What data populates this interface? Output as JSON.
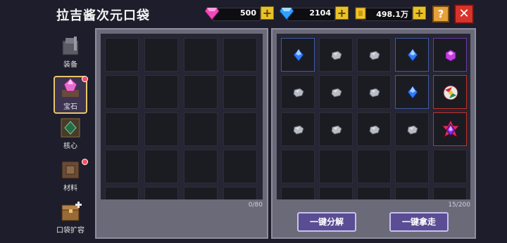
{
  "header": {
    "title": "拉吉酱次元口袋",
    "currencies": [
      {
        "name": "pink-gem",
        "value": "500"
      },
      {
        "name": "blue-gem",
        "value": "2104"
      },
      {
        "name": "coin",
        "value": "498.1万"
      }
    ],
    "help_label": "?",
    "close_label": "✕"
  },
  "nav": [
    {
      "label": "装备",
      "icon": "armor-icon",
      "badge": false
    },
    {
      "label": "宝石",
      "icon": "gem-crystal-icon",
      "badge": true,
      "active": true
    },
    {
      "label": "核心",
      "icon": "core-icon",
      "badge": false
    },
    {
      "label": "材料",
      "icon": "material-box-icon",
      "badge": true
    },
    {
      "label": "口袋扩容",
      "icon": "chest-expand-icon",
      "badge": false
    }
  ],
  "left_panel": {
    "count": "0/80"
  },
  "right_panel": {
    "count": "15/200",
    "items": [
      "blue-gem",
      "stone",
      "stone",
      "blue-gem",
      "purple-gem",
      "stone",
      "stone",
      "stone",
      "blue-gem",
      "orb",
      "stone",
      "stone",
      "stone",
      "stone",
      "red-gem"
    ]
  },
  "buttons": {
    "decompose": "一键分解",
    "take": "一键拿走"
  },
  "colors": {
    "accent": "#5a4d93",
    "gold": "#e9c22a",
    "close": "#d8332a"
  }
}
